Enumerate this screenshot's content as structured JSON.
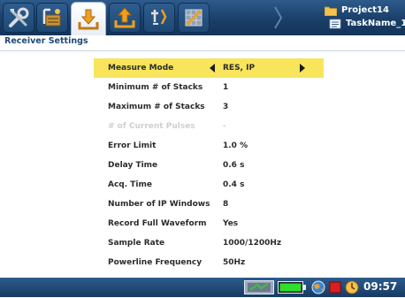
{
  "toolbar": {
    "tabs": [
      {
        "name": "tools-tab",
        "icon": "tools-icon"
      },
      {
        "name": "survey-tab",
        "icon": "survey-line-icon"
      },
      {
        "name": "download-tab",
        "icon": "download-icon",
        "active": true
      },
      {
        "name": "upload-tab",
        "icon": "upload-icon"
      },
      {
        "name": "electrode-tab",
        "icon": "electrode-icon"
      },
      {
        "name": "grid-tab",
        "icon": "grid-crossed-icon"
      }
    ]
  },
  "project": {
    "name": "Project14",
    "task": "TaskName_1"
  },
  "page": {
    "title": "Receiver Settings"
  },
  "settings": [
    {
      "label": "Measure Mode",
      "value": "RES, IP",
      "selected": true
    },
    {
      "label": "Minimum # of Stacks",
      "value": "1"
    },
    {
      "label": "Maximum # of Stacks",
      "value": "3"
    },
    {
      "label": "# of Current Pulses",
      "value": "-",
      "disabled": true
    },
    {
      "label": "Error Limit",
      "value": "1.0 %"
    },
    {
      "label": "Delay Time",
      "value": "0.6 s"
    },
    {
      "label": "Acq. Time",
      "value": "0.4 s"
    },
    {
      "label": "Number of IP Windows",
      "value": "8"
    },
    {
      "label": "Record Full Waveform",
      "value": "Yes"
    },
    {
      "label": "Sample Rate",
      "value": "1000/1200Hz"
    },
    {
      "label": "Powerline Frequency",
      "value": "50Hz"
    }
  ],
  "status_bar": {
    "icons": [
      "transmitter-icon",
      "battery-icon",
      "gps-globe-icon",
      "record-stop-icon",
      "clock-icon"
    ],
    "battery_level": 1.0,
    "time": "09:57"
  },
  "colors": {
    "toolbar_blue": "#1a3f68",
    "selection_yellow": "#f8e55c",
    "title_blue": "#1f4a78",
    "disabled_text": "#cfcfcf"
  }
}
